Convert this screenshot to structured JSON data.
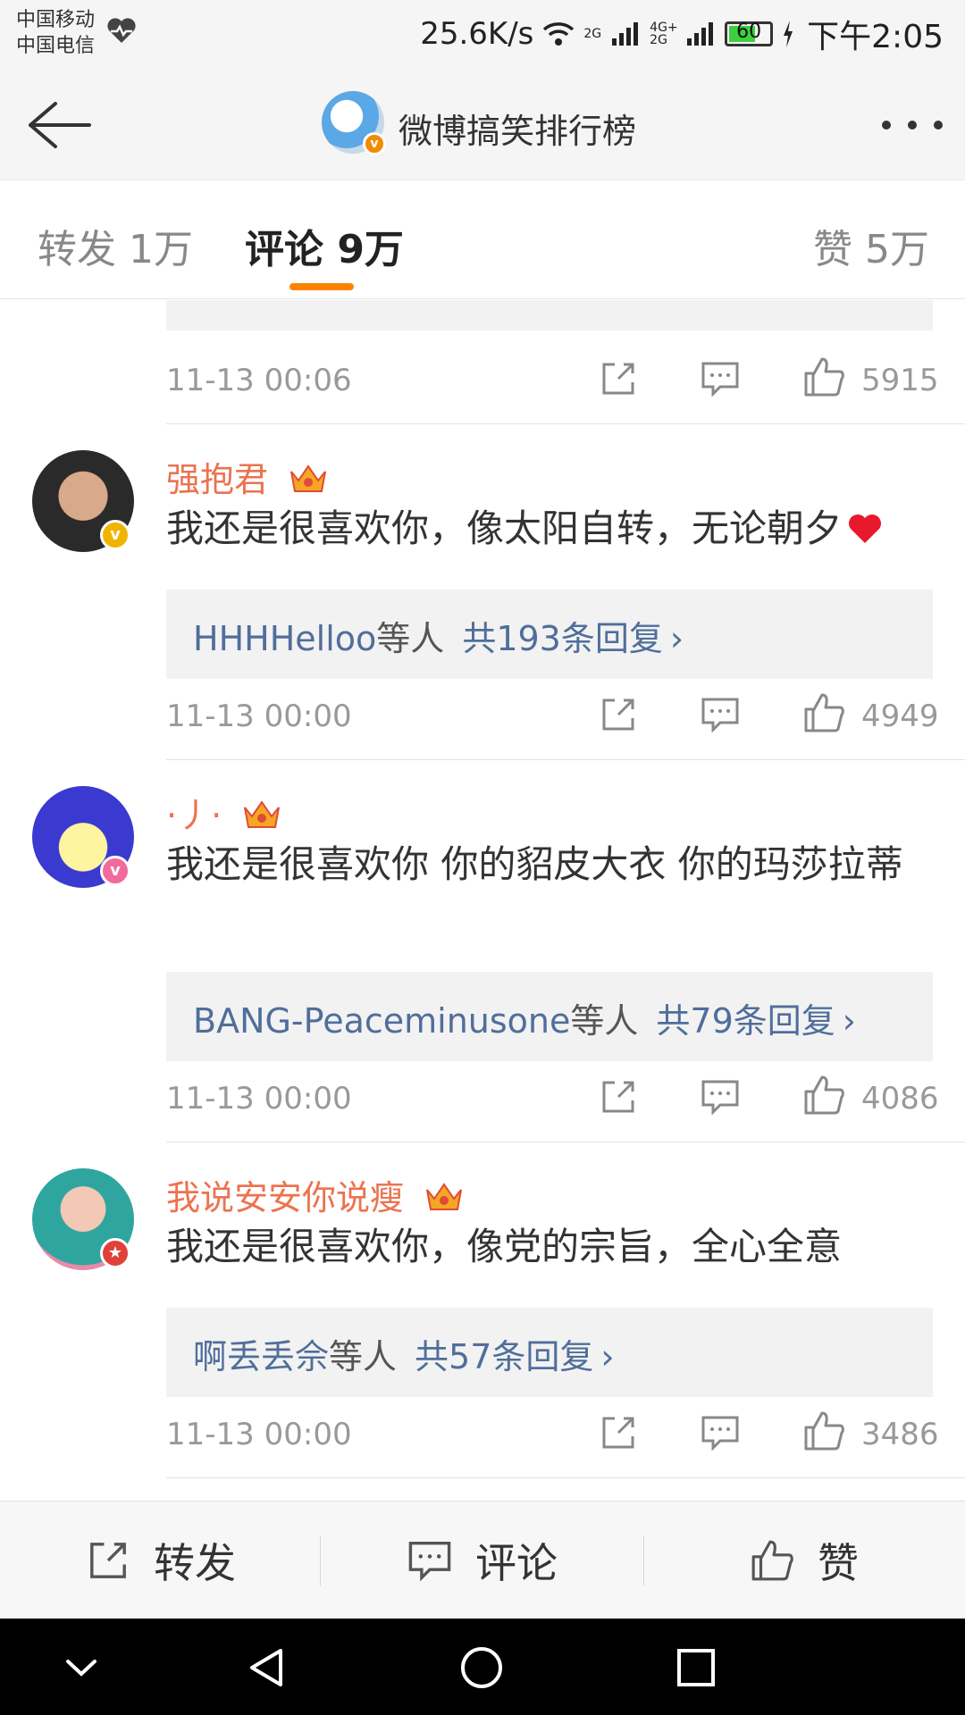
{
  "status_bar": {
    "carrier_1": "中国移动",
    "carrier_2": "中国电信",
    "speed": "25.6K/s",
    "net_1": "2G",
    "net_2": "4G+ 2G",
    "battery": "60",
    "time": "下午2:05"
  },
  "header": {
    "title": "微博搞笑排行榜",
    "back_icon": "arrow-left-icon",
    "more_icon": "more-dots-icon"
  },
  "tabs": [
    {
      "label": "转发 1万",
      "active": false
    },
    {
      "label": "评论 9万",
      "active": true
    },
    {
      "label": "赞 5万",
      "active": false
    }
  ],
  "comments": [
    {
      "name": "",
      "text": "",
      "reply_who": "",
      "reply_mid": "",
      "reply_count": "",
      "time": "11-13 00:06",
      "likes": "5915"
    },
    {
      "name": "强抱君",
      "text": "我还是很喜欢你，像太阳自转，无论朝夕",
      "reply_who": "HHHHelloo",
      "reply_mid": "等人",
      "reply_count": "共193条回复",
      "time": "11-13 00:00",
      "likes": "4949"
    },
    {
      "name": "·丿·",
      "text": "我还是很喜欢你 你的貂皮大衣 你的玛莎拉蒂",
      "reply_who": "BANG-Peaceminusone",
      "reply_mid": "等人",
      "reply_count": "共79条回复",
      "time": "11-13 00:00",
      "likes": "4086"
    },
    {
      "name": "我说安安你说瘦",
      "text": "我还是很喜欢你，像党的宗旨，全心全意",
      "reply_who": "啊丢丢佘",
      "reply_mid": "等人",
      "reply_count": "共57条回复",
      "time": "11-13 00:00",
      "likes": "3486"
    }
  ],
  "bottom_bar": {
    "repost": "转发",
    "comment": "评论",
    "like": "赞"
  },
  "colors": {
    "accent": "#ff8200",
    "username": "#eb7350",
    "link": "#506e9b"
  }
}
